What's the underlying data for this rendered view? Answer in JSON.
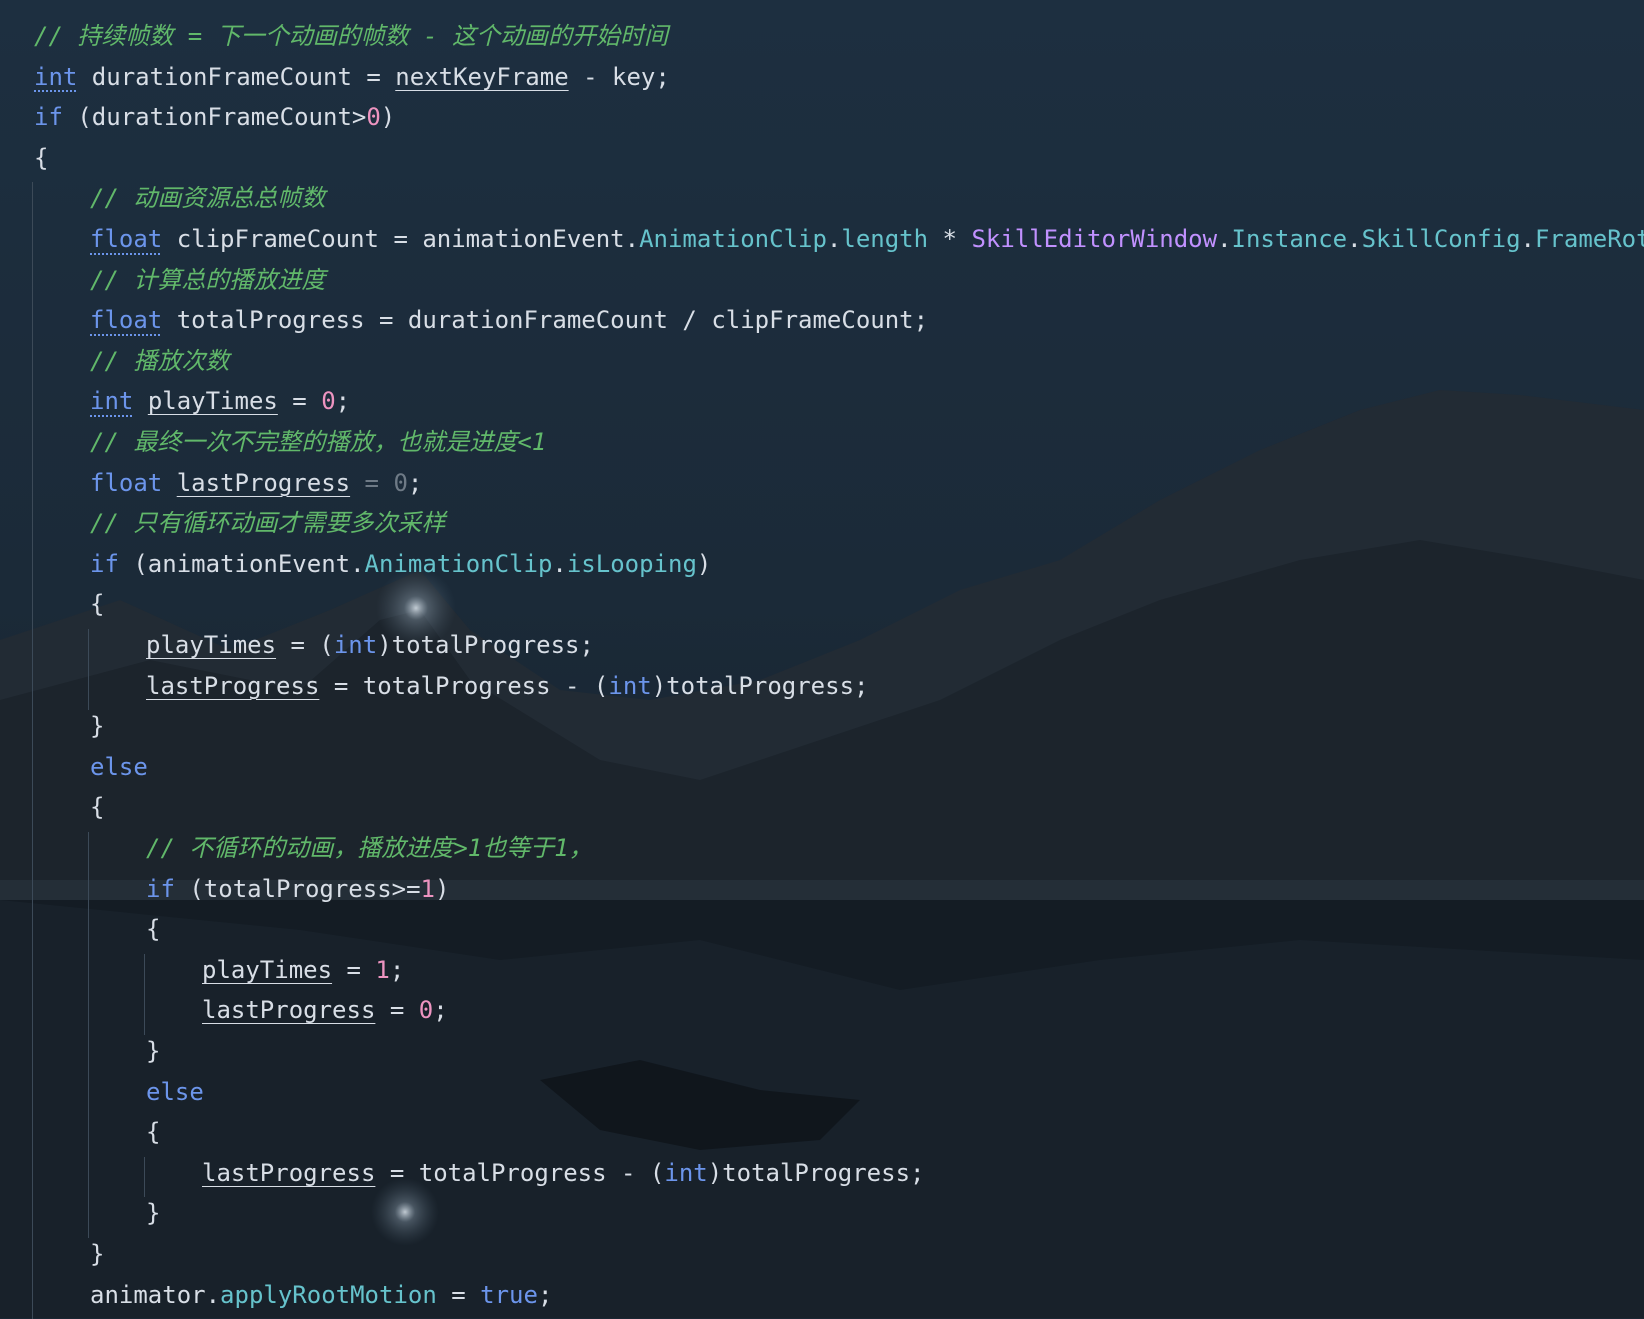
{
  "editor": {
    "language": "C#",
    "colors": {
      "comment": "#61b86a",
      "keyword": "#6c95eb",
      "number": "#ed94c0",
      "field": "#66c3cc",
      "class": "#c191ff",
      "identifier": "#d8dee6",
      "indent_guide": "#3c4a58"
    },
    "lines": [
      {
        "indent": 0,
        "tokens": [
          {
            "t": "// 持续帧数 = 下一个动画的帧数 - 这个动画的开始时间",
            "s": "comment"
          }
        ]
      },
      {
        "indent": 0,
        "tokens": [
          {
            "t": "int",
            "s": "kw dot"
          },
          {
            "t": " durationFrameCount = "
          },
          {
            "t": "nextKeyFrame",
            "s": "ul"
          },
          {
            "t": " - key;"
          }
        ]
      },
      {
        "indent": 0,
        "tokens": [
          {
            "t": "if",
            "s": "kw"
          },
          {
            "t": " (durationFrameCount>"
          },
          {
            "t": "0",
            "s": "num"
          },
          {
            "t": ")"
          }
        ]
      },
      {
        "indent": 0,
        "tokens": [
          {
            "t": "{"
          }
        ]
      },
      {
        "indent": 1,
        "tokens": [
          {
            "t": "// 动画资源总总帧数",
            "s": "comment"
          }
        ]
      },
      {
        "indent": 1,
        "tokens": [
          {
            "t": "float",
            "s": "kw dot"
          },
          {
            "t": " clipFrameCount = animationEvent."
          },
          {
            "t": "AnimationClip",
            "s": "field"
          },
          {
            "t": "."
          },
          {
            "t": "length",
            "s": "field"
          },
          {
            "t": " * "
          },
          {
            "t": "SkillEditorWindow",
            "s": "cls"
          },
          {
            "t": "."
          },
          {
            "t": "Instance",
            "s": "field"
          },
          {
            "t": "."
          },
          {
            "t": "SkillConfig",
            "s": "field"
          },
          {
            "t": "."
          },
          {
            "t": "FrameRote",
            "s": "field"
          },
          {
            "t": ";"
          }
        ]
      },
      {
        "indent": 1,
        "tokens": [
          {
            "t": "// 计算总的播放进度",
            "s": "comment"
          }
        ]
      },
      {
        "indent": 1,
        "tokens": [
          {
            "t": "float",
            "s": "kw dot"
          },
          {
            "t": " totalProgress = durationFrameCount / clipFrameCount;"
          }
        ]
      },
      {
        "indent": 1,
        "tokens": [
          {
            "t": "// 播放次数",
            "s": "comment"
          }
        ]
      },
      {
        "indent": 1,
        "tokens": [
          {
            "t": "int",
            "s": "kw dot"
          },
          {
            "t": " "
          },
          {
            "t": "playTimes",
            "s": "ul"
          },
          {
            "t": " = "
          },
          {
            "t": "0",
            "s": "num"
          },
          {
            "t": ";"
          }
        ]
      },
      {
        "indent": 1,
        "tokens": [
          {
            "t": "// 最终一次不完整的播放，也就是进度<1",
            "s": "comment"
          }
        ]
      },
      {
        "indent": 1,
        "tokens": [
          {
            "t": "float",
            "s": "kw"
          },
          {
            "t": " "
          },
          {
            "t": "lastProgress",
            "s": "ul"
          },
          {
            "t": " = ",
            "s": "faint"
          },
          {
            "t": "0",
            "s": "faint"
          },
          {
            "t": ";"
          }
        ]
      },
      {
        "indent": 1,
        "tokens": [
          {
            "t": "// 只有循环动画才需要多次采样",
            "s": "comment"
          }
        ]
      },
      {
        "indent": 1,
        "tokens": [
          {
            "t": "if",
            "s": "kw"
          },
          {
            "t": " (animationEvent."
          },
          {
            "t": "AnimationClip",
            "s": "field"
          },
          {
            "t": "."
          },
          {
            "t": "isLooping",
            "s": "field"
          },
          {
            "t": ")"
          }
        ]
      },
      {
        "indent": 1,
        "tokens": [
          {
            "t": "{"
          }
        ]
      },
      {
        "indent": 2,
        "tokens": [
          {
            "t": "playTimes",
            "s": "ul"
          },
          {
            "t": " = ("
          },
          {
            "t": "int",
            "s": "kw"
          },
          {
            "t": ")totalProgress;"
          }
        ]
      },
      {
        "indent": 2,
        "tokens": [
          {
            "t": "lastProgress",
            "s": "ul"
          },
          {
            "t": " = totalProgress - ("
          },
          {
            "t": "int",
            "s": "kw"
          },
          {
            "t": ")totalProgress;"
          }
        ]
      },
      {
        "indent": 1,
        "tokens": [
          {
            "t": "}"
          }
        ]
      },
      {
        "indent": 1,
        "tokens": [
          {
            "t": "else",
            "s": "kw"
          }
        ]
      },
      {
        "indent": 1,
        "tokens": [
          {
            "t": "{"
          }
        ]
      },
      {
        "indent": 2,
        "tokens": [
          {
            "t": "// 不循环的动画，播放进度>1也等于1，",
            "s": "comment"
          }
        ]
      },
      {
        "indent": 2,
        "tokens": [
          {
            "t": "if",
            "s": "kw"
          },
          {
            "t": " (totalProgress>="
          },
          {
            "t": "1",
            "s": "num"
          },
          {
            "t": ")"
          }
        ]
      },
      {
        "indent": 2,
        "tokens": [
          {
            "t": "{"
          }
        ]
      },
      {
        "indent": 3,
        "tokens": [
          {
            "t": "playTimes",
            "s": "ul"
          },
          {
            "t": " = "
          },
          {
            "t": "1",
            "s": "num"
          },
          {
            "t": ";"
          }
        ]
      },
      {
        "indent": 3,
        "tokens": [
          {
            "t": "lastProgress",
            "s": "ul"
          },
          {
            "t": " = "
          },
          {
            "t": "0",
            "s": "num"
          },
          {
            "t": ";"
          }
        ]
      },
      {
        "indent": 2,
        "tokens": [
          {
            "t": "}"
          }
        ]
      },
      {
        "indent": 2,
        "tokens": [
          {
            "t": "else",
            "s": "kw"
          }
        ]
      },
      {
        "indent": 2,
        "tokens": [
          {
            "t": "{"
          }
        ]
      },
      {
        "indent": 3,
        "tokens": [
          {
            "t": "lastProgress",
            "s": "ul"
          },
          {
            "t": " = totalProgress - ("
          },
          {
            "t": "int",
            "s": "kw"
          },
          {
            "t": ")totalProgress;"
          }
        ]
      },
      {
        "indent": 2,
        "tokens": [
          {
            "t": "}"
          }
        ]
      },
      {
        "indent": 1,
        "tokens": [
          {
            "t": "}"
          }
        ]
      },
      {
        "indent": 1,
        "tokens": [
          {
            "t": "animator."
          },
          {
            "t": "applyRootMotion",
            "s": "field"
          },
          {
            "t": " = "
          },
          {
            "t": "true",
            "s": "kw"
          },
          {
            "t": ";"
          }
        ]
      }
    ]
  }
}
